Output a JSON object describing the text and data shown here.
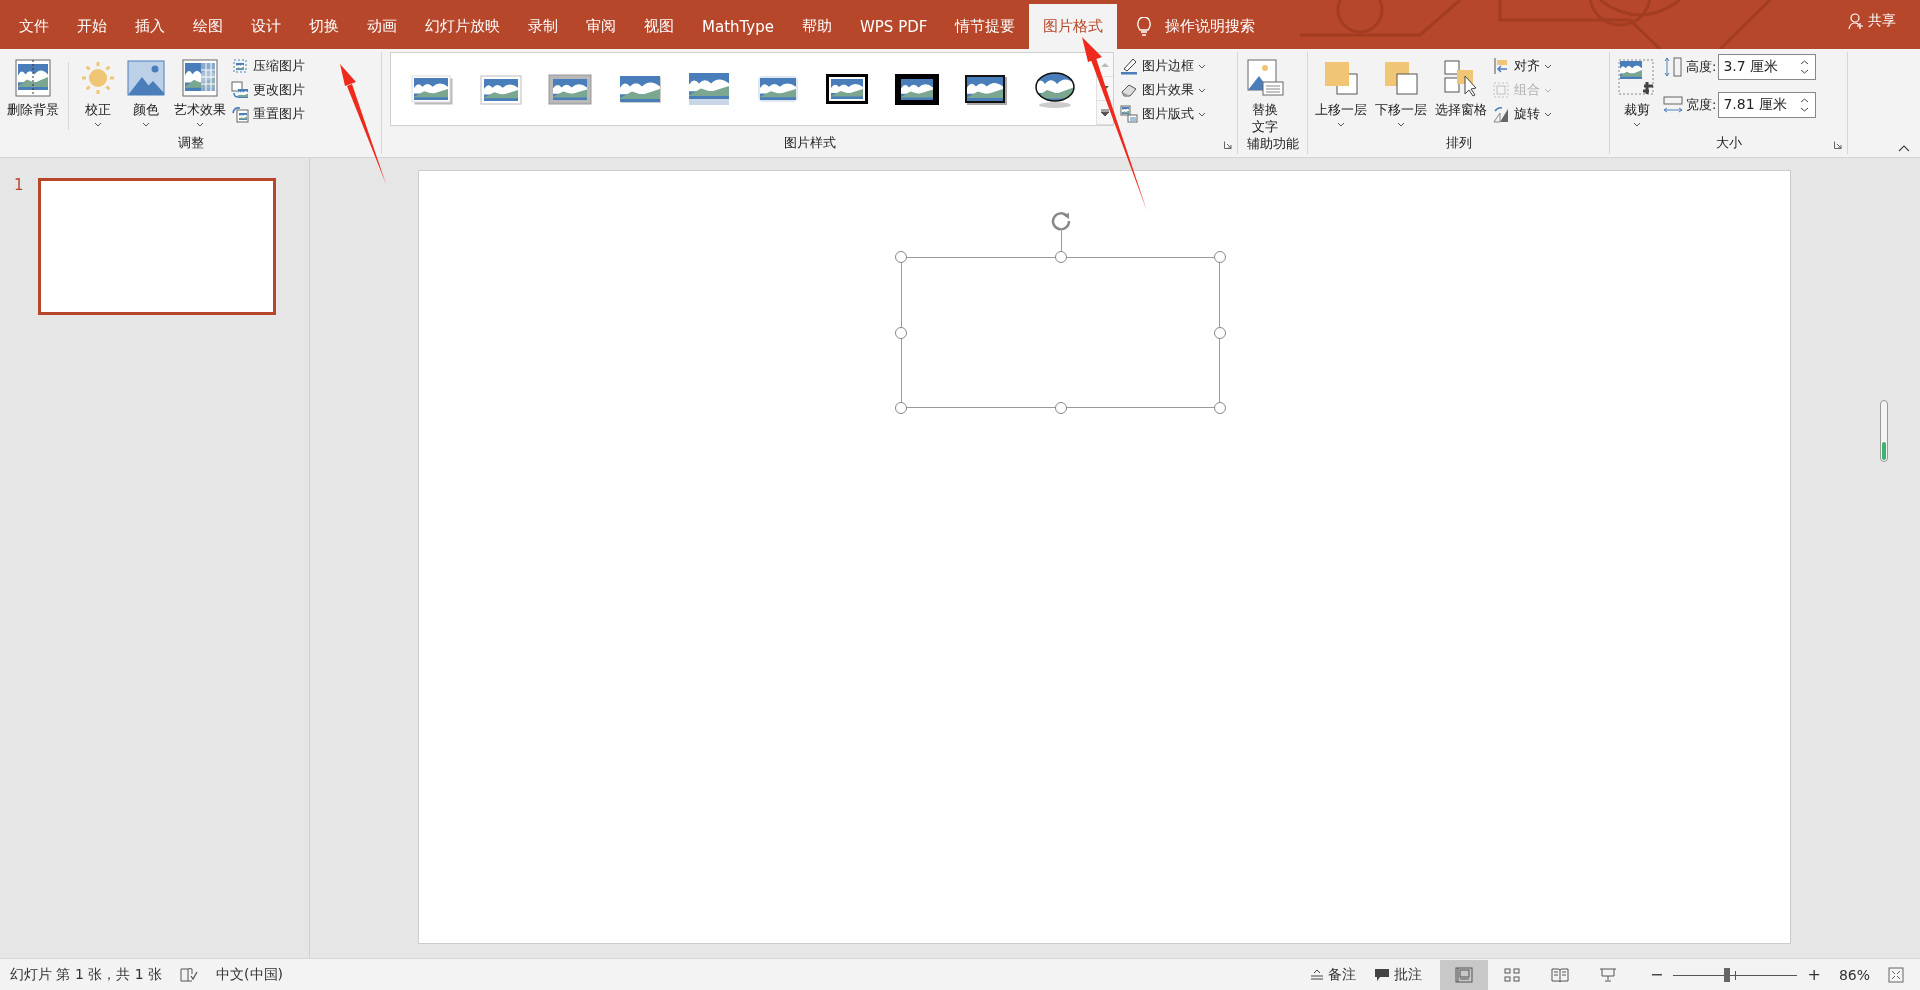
{
  "tabs": [
    {
      "label": "文件",
      "selected": false
    },
    {
      "label": "开始",
      "selected": false
    },
    {
      "label": "插入",
      "selected": false
    },
    {
      "label": "绘图",
      "selected": false
    },
    {
      "label": "设计",
      "selected": false
    },
    {
      "label": "切换",
      "selected": false
    },
    {
      "label": "动画",
      "selected": false
    },
    {
      "label": "幻灯片放映",
      "selected": false
    },
    {
      "label": "录制",
      "selected": false
    },
    {
      "label": "审阅",
      "selected": false
    },
    {
      "label": "视图",
      "selected": false
    },
    {
      "label": "MathType",
      "selected": false
    },
    {
      "label": "帮助",
      "selected": false
    },
    {
      "label": "WPS PDF",
      "selected": false
    },
    {
      "label": "情节提要",
      "selected": false
    },
    {
      "label": "图片格式",
      "selected": true
    }
  ],
  "tell_me": {
    "label": "操作说明搜索"
  },
  "share": {
    "label": "共享"
  },
  "ribbon": {
    "adjust": {
      "title": "调整",
      "large_buttons": [
        {
          "kind": "remove-background",
          "label": "删除背景",
          "dropdown": false
        },
        {
          "kind": "corrections",
          "label": "校正",
          "dropdown": true
        },
        {
          "kind": "color",
          "label": "颜色",
          "dropdown": true
        },
        {
          "kind": "artistic",
          "label": "艺术效果",
          "dropdown": true
        }
      ],
      "small_buttons": [
        {
          "kind": "compress",
          "label": "压缩图片",
          "dropdown": false,
          "disabled": false
        },
        {
          "kind": "change",
          "label": "更改图片",
          "dropdown": false,
          "disabled": false
        },
        {
          "kind": "reset",
          "label": "重置图片",
          "dropdown": false,
          "disabled": false
        }
      ]
    },
    "picture_styles": {
      "title": "图片样式",
      "styles": [
        {
          "kind": "shadow"
        },
        {
          "kind": "white-frame"
        },
        {
          "kind": "grey-frame"
        },
        {
          "kind": "soft-shadow"
        },
        {
          "kind": "reflected"
        },
        {
          "kind": "soft-edge"
        },
        {
          "kind": "double-frame"
        },
        {
          "kind": "thick-black"
        },
        {
          "kind": "black-shadow"
        },
        {
          "kind": "oval"
        }
      ],
      "small_buttons": [
        {
          "kind": "border",
          "label": "图片边框",
          "dropdown": true,
          "disabled": false
        },
        {
          "kind": "effects",
          "label": "图片效果",
          "dropdown": true,
          "disabled": false
        },
        {
          "kind": "layout",
          "label": "图片版式",
          "dropdown": true,
          "disabled": false
        }
      ]
    },
    "accessibility": {
      "title": "辅助功能",
      "alt_text": "替换文字"
    },
    "arrange": {
      "title": "排列",
      "large_buttons": [
        {
          "kind": "forward",
          "label": "上移一层",
          "dropdown": true
        },
        {
          "kind": "backward",
          "label": "下移一层",
          "dropdown": true
        },
        {
          "kind": "pane",
          "label": "选择窗格",
          "dropdown": false
        }
      ],
      "small_buttons": [
        {
          "kind": "align",
          "label": "对齐",
          "dropdown": true,
          "disabled": false
        },
        {
          "kind": "group",
          "label": "组合",
          "dropdown": true,
          "disabled": true
        },
        {
          "kind": "rotate",
          "label": "旋转",
          "dropdown": true,
          "disabled": false
        }
      ]
    },
    "size": {
      "title": "大小",
      "crop": "裁剪",
      "height": {
        "label": "高度:",
        "value": "3.7 厘米"
      },
      "width": {
        "label": "宽度:",
        "value": "7.81 厘米"
      }
    }
  },
  "slides": [
    {
      "number": "1",
      "selected": true
    }
  ],
  "shape": {
    "selected": true
  },
  "status_bar": {
    "slide_info": "幻灯片 第 1 张，共 1 张",
    "language": "中文(中国)",
    "notes": "备注",
    "comments": "批注",
    "views": [
      {
        "kind": "normal",
        "selected": true
      },
      {
        "kind": "sorter",
        "selected": false
      },
      {
        "kind": "reading",
        "selected": false
      },
      {
        "kind": "slideshow",
        "selected": false
      }
    ],
    "zoom": {
      "out": "−",
      "level": 0.43,
      "in": "+",
      "reading": "86%"
    }
  }
}
